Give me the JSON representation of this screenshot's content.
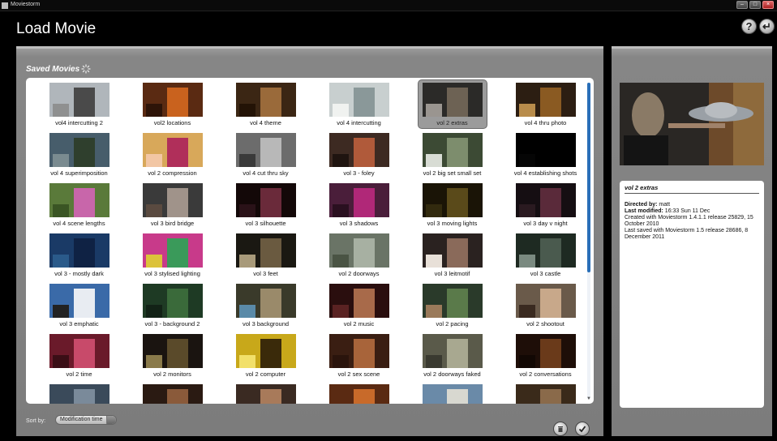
{
  "window": {
    "app_title": "Moviestorm"
  },
  "header": {
    "title": "Load Movie",
    "help_label": "?",
    "exit_label": "↵"
  },
  "saved_movies": {
    "title": "Saved Movies",
    "items": [
      {
        "label": "vol4 intercutting 2",
        "colors": [
          "#b0b6bb",
          "#4a4a4a",
          "#8f9090"
        ]
      },
      {
        "label": "vol2 locations",
        "colors": [
          "#5a2a12",
          "#c9621e",
          "#2e1408"
        ]
      },
      {
        "label": "vol 4 theme",
        "colors": [
          "#3b2614",
          "#9a6a3a",
          "#231306"
        ]
      },
      {
        "label": "vol 4 intercutting",
        "colors": [
          "#c8cfcf",
          "#8a9899",
          "#f0f2f0"
        ]
      },
      {
        "label": "vol 2 extras",
        "colors": [
          "#2b2a28",
          "#6d6254",
          "#9a9590"
        ]
      },
      {
        "label": "vol 4 thru photo",
        "colors": [
          "#2c1e12",
          "#8a5a22",
          "#b88c4b"
        ]
      },
      {
        "label": "vol 4 superimposition",
        "colors": [
          "#475d6b",
          "#2f3f2d",
          "#7a8b90"
        ]
      },
      {
        "label": "vol 2 compression",
        "colors": [
          "#d8a85a",
          "#b02f5a",
          "#f2c6a4"
        ]
      },
      {
        "label": "vol 4 cut thru sky",
        "colors": [
          "#6c6c6c",
          "#b8b8b8",
          "#3a3a3a"
        ]
      },
      {
        "label": "vol 3 - foley",
        "colors": [
          "#3d2a22",
          "#b05a3a",
          "#1f1410"
        ]
      },
      {
        "label": "vol 2 big set small set",
        "colors": [
          "#3c4a34",
          "#7d8d6d",
          "#d8dcd4"
        ]
      },
      {
        "label": "vol 4 establishing shots",
        "colors": [
          "#000000",
          "#000000",
          "#050505"
        ]
      },
      {
        "label": "vol 4 scene lengths",
        "colors": [
          "#5a7a3a",
          "#c866aa",
          "#3a5524"
        ]
      },
      {
        "label": "vol 3 bird bridge",
        "colors": [
          "#3a3a3a",
          "#a0938a",
          "#5a4a40"
        ]
      },
      {
        "label": "vol 3 silhouette",
        "colors": [
          "#130808",
          "#6a2a3a",
          "#2a1218"
        ]
      },
      {
        "label": "vol 3 shadows",
        "colors": [
          "#4a1e3a",
          "#b02878",
          "#2a1020"
        ]
      },
      {
        "label": "vol 3 moving lights",
        "colors": [
          "#1a1406",
          "#5a4a1a",
          "#322a0e"
        ]
      },
      {
        "label": "vol 3 day v night",
        "colors": [
          "#150e12",
          "#5a2a3a",
          "#2a1a20"
        ]
      },
      {
        "label": "vol 3 - mostly dark",
        "colors": [
          "#1a3a66",
          "#0f2244",
          "#2a5a8a"
        ]
      },
      {
        "label": "vol 3 stylised lighting",
        "colors": [
          "#c83a8a",
          "#3a9a5a",
          "#dcc23a"
        ]
      },
      {
        "label": "vol 3 feet",
        "colors": [
          "#1a1812",
          "#6a5a40",
          "#a89a7a"
        ]
      },
      {
        "label": "vol 2 doorways",
        "colors": [
          "#6a7466",
          "#a7b0a2",
          "#4a5444"
        ]
      },
      {
        "label": "vol 3 leitmotif",
        "colors": [
          "#2a2220",
          "#8a6a5a",
          "#e8e0d8"
        ]
      },
      {
        "label": "vol 3 castle",
        "colors": [
          "#1e2a22",
          "#4a5a4e",
          "#7a8a80"
        ]
      },
      {
        "label": "vol 3 emphatic",
        "colors": [
          "#3a6aa8",
          "#e8ecf2",
          "#222"
        ]
      },
      {
        "label": "vol 3 - background 2",
        "colors": [
          "#1e3a24",
          "#3a6a3a",
          "#122216"
        ]
      },
      {
        "label": "vol 3 background",
        "colors": [
          "#3a3a2a",
          "#9a8a6a",
          "#5a8aa8"
        ]
      },
      {
        "label": "vol 2 music",
        "colors": [
          "#2a0e0e",
          "#a86a4a",
          "#5a2222"
        ]
      },
      {
        "label": "vol 2 pacing",
        "colors": [
          "#2a3a2a",
          "#5a7a4a",
          "#9a7a5a"
        ]
      },
      {
        "label": "vol 2 shootout",
        "colors": [
          "#6a5a4a",
          "#c8a88a",
          "#3a2a20"
        ]
      },
      {
        "label": "vol 2 time",
        "colors": [
          "#6a1a2a",
          "#c84a6a",
          "#3a0e16"
        ]
      },
      {
        "label": "vol 2 monitors",
        "colors": [
          "#1a1410",
          "#5a4a2a",
          "#8a7a4a"
        ]
      },
      {
        "label": "vol 2 computer",
        "colors": [
          "#c8a81a",
          "#3a2a0a",
          "#f2e06a"
        ]
      },
      {
        "label": "vol 2 sex scene",
        "colors": [
          "#3a1e12",
          "#a8643a",
          "#2a140c"
        ]
      },
      {
        "label": "vol 2 doorways faked",
        "colors": [
          "#5a5a4a",
          "#a8a890",
          "#3a3a30"
        ]
      },
      {
        "label": "vol 2 conversations",
        "colors": [
          "#1e0e08",
          "#6a3a1a",
          "#120804"
        ]
      },
      {
        "label": "",
        "colors": [
          "#3a4a5a",
          "#7a8a9a",
          "#22303a"
        ]
      },
      {
        "label": "",
        "colors": [
          "#2a1a12",
          "#8a5a3a",
          "#1a100a"
        ]
      },
      {
        "label": "",
        "colors": [
          "#3a2a22",
          "#a87a5a",
          "#22180f"
        ]
      },
      {
        "label": "",
        "colors": [
          "#5a2a12",
          "#c86a2a",
          "#2a1408"
        ]
      },
      {
        "label": "",
        "colors": [
          "#6a8aa8",
          "#d8d8d0",
          "#3a4a5a"
        ]
      },
      {
        "label": "",
        "colors": [
          "#3a2a1a",
          "#8a6a4a",
          "#22180e"
        ]
      }
    ],
    "selected_index": 4,
    "scroll_fraction": 0.6
  },
  "sort": {
    "label": "Sort by:",
    "selected": "Modification time"
  },
  "details": {
    "title": "vol 2 extras",
    "directed_by_label": "Directed by:",
    "directed_by": "matt",
    "last_modified_label": "Last modified:",
    "last_modified": "16:33 Sun 11 Dec",
    "created_with": "Created with Moviestorm 1.4.1.1 release 25829, 15 October 2010",
    "last_saved_with": "Last saved with Moviestorm 1.5 release 28686, 8 December 2011"
  },
  "colors": {
    "panel": "#868686",
    "selection_bg": "#9b9b9b",
    "scroll_accent": "#2a6fb8"
  }
}
